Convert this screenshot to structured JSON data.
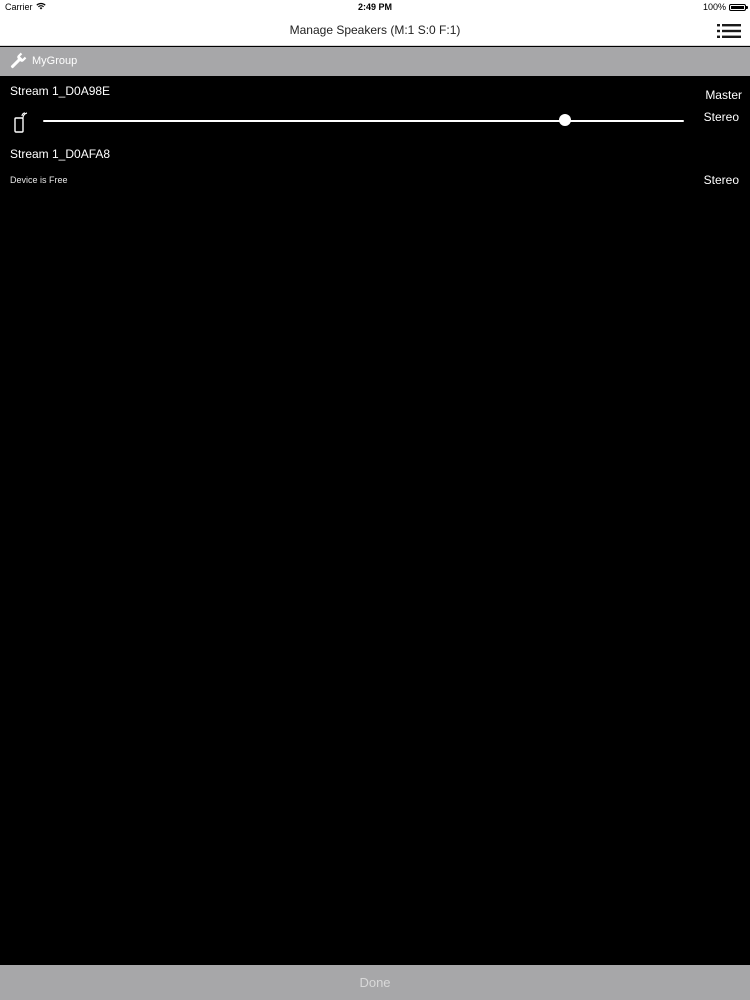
{
  "status_bar": {
    "carrier": "Carrier",
    "time": "2:49 PM",
    "battery": "100%",
    "battery_level": 1.0
  },
  "nav": {
    "title": "Manage Speakers (M:1 S:0 F:1)",
    "menu_icon": "list-menu-icon"
  },
  "group": {
    "icon": "wrench-icon",
    "name": "MyGroup"
  },
  "speakers": [
    {
      "name": "Stream 1_D0A98E",
      "role": "Master",
      "mode": "Stereo",
      "icon": "remote-icon",
      "volume": 0.815
    },
    {
      "name": "Stream 1_D0AFA8",
      "status": "Device is Free",
      "mode": "Stereo"
    }
  ],
  "footer": {
    "done_label": "Done"
  },
  "colors": {
    "background": "#000000",
    "bar_gray": "#a7a7a9",
    "text_white": "#ffffff"
  }
}
